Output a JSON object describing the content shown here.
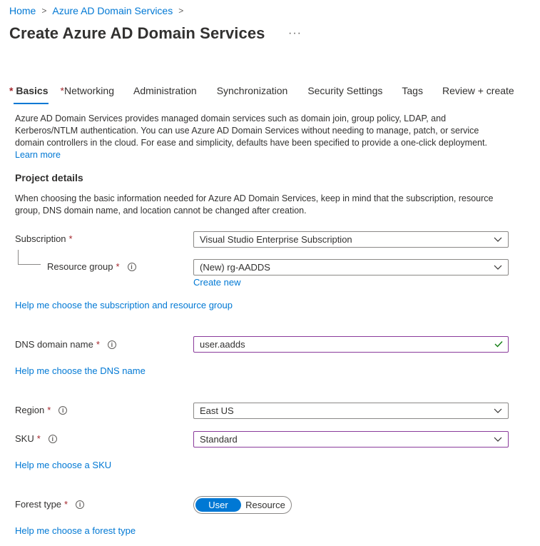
{
  "breadcrumb": {
    "home": "Home",
    "service": "Azure AD Domain Services"
  },
  "page": {
    "title": "Create Azure AD Domain Services",
    "more": "···"
  },
  "tabs": [
    {
      "label": "Basics",
      "required": "*"
    },
    {
      "label": "Networking",
      "required": "*"
    },
    {
      "label": "Administration"
    },
    {
      "label": "Synchronization"
    },
    {
      "label": "Security Settings"
    },
    {
      "label": "Tags"
    },
    {
      "label": "Review + create"
    }
  ],
  "intro": {
    "text": "Azure AD Domain Services provides managed domain services such as domain join, group policy, LDAP, and Kerberos/NTLM authentication. You can use Azure AD Domain Services without needing to manage, patch, or service domain controllers in the cloud. For ease and simplicity, defaults have been specified to provide a one-click deployment.",
    "learn_more": "Learn more"
  },
  "project": {
    "title": "Project details",
    "description": "When choosing the basic information needed for Azure AD Domain Services, keep in mind that the subscription, resource group, DNS domain name, and location cannot be changed after creation."
  },
  "form": {
    "required_mark": "*",
    "subscription": {
      "label": "Subscription",
      "value": "Visual Studio Enterprise Subscription"
    },
    "resource_group": {
      "label": "Resource group",
      "value": "(New) rg-AADDS",
      "create_new": "Create new"
    },
    "help_subscription": "Help me choose the subscription and resource group",
    "dns": {
      "label": "DNS domain name",
      "value": "user.aadds"
    },
    "help_dns": "Help me choose the DNS name",
    "region": {
      "label": "Region",
      "value": "East US"
    },
    "sku": {
      "label": "SKU",
      "value": "Standard"
    },
    "help_sku": "Help me choose a SKU",
    "forest": {
      "label": "Forest type",
      "options": [
        "User",
        "Resource"
      ],
      "selected": "User"
    },
    "help_forest": "Help me choose a forest type"
  },
  "info_glyph": "i",
  "colors": {
    "accent": "#0078d4",
    "required": "#a4262c",
    "focus_border": "#8a3a9b"
  }
}
